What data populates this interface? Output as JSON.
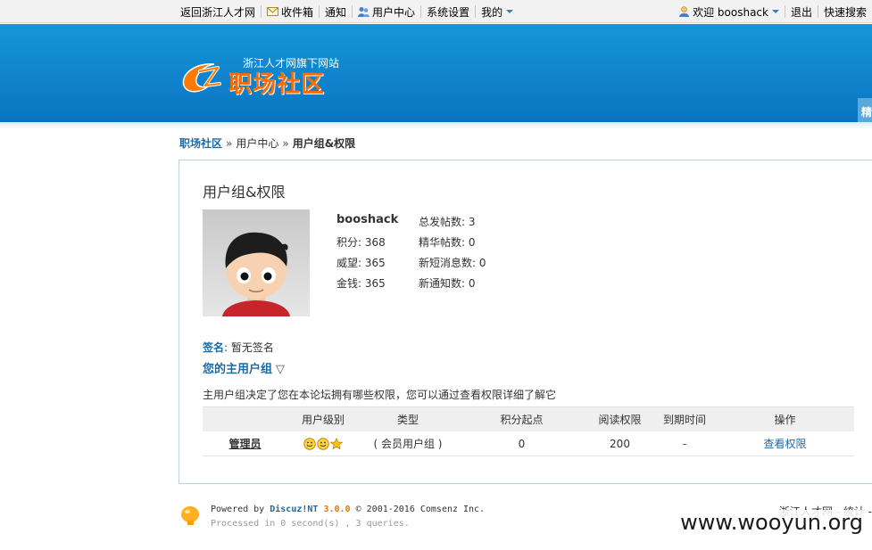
{
  "topbar": {
    "left": [
      "返回浙江人才网",
      "收件箱",
      "通知",
      "用户中心",
      "系统设置",
      "我的"
    ],
    "welcome": "欢迎 booshack",
    "logout": "退出",
    "quick_search": "快速搜索"
  },
  "header": {
    "logo_sub": "浙江人才网旗下网站",
    "logo_main": "职场社区",
    "side_tab": "精"
  },
  "breadcrumb": {
    "home": "职场社区",
    "sep": "»",
    "items": [
      "用户中心",
      "用户组&权限"
    ]
  },
  "page": {
    "title": "用户组&权限"
  },
  "profile": {
    "username": "booshack",
    "left_stats": [
      "积分: 368",
      "威望: 365",
      "金钱: 365"
    ],
    "right_stats": [
      "总发帖数: 3",
      "精华帖数: 0",
      "新短消息数: 0",
      "新通知数: 0"
    ],
    "signature_label": "签名",
    "signature_value": ": 暂无签名"
  },
  "group": {
    "title": "您的主用户组",
    "toggle": "▽",
    "description": "主用户组决定了您在本论坛拥有哪些权限，您可以通过查看权限详细了解它"
  },
  "table": {
    "headers": [
      "",
      "用户级别",
      "类型",
      "积分起点",
      "阅读权限",
      "到期时间",
      "操作"
    ],
    "rows": [
      {
        "name": "管理员",
        "type": "( 会员用户组 )",
        "points": "0",
        "read": "200",
        "expire": "-",
        "action": "查看权限"
      }
    ]
  },
  "footer": {
    "powered_prefix": "Powered by",
    "brand": "Discuz!NT",
    "version": "3.0.0",
    "copyright": "© 2001-2016 Comsenz Inc.",
    "processed": "Processed in 0 second(s) , 3 queries.",
    "right": "浙江人才网 - 统计 -"
  },
  "watermark": "www.wooyun.org"
}
